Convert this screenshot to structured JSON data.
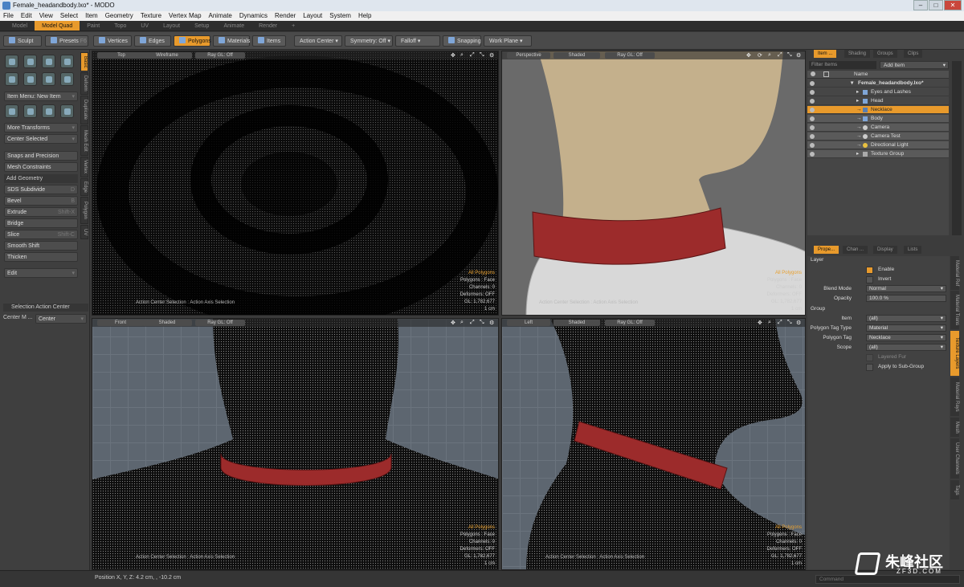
{
  "window": {
    "title": "Female_headandbody.lxo* - MODO",
    "controls": [
      "–",
      "□",
      "✕"
    ]
  },
  "menu": [
    "File",
    "Edit",
    "View",
    "Select",
    "Item",
    "Geometry",
    "Texture",
    "Vertex Map",
    "Animate",
    "Dynamics",
    "Render",
    "Layout",
    "System",
    "Help"
  ],
  "layout_tabs": [
    {
      "label": "Model",
      "active": false
    },
    {
      "label": "Model Quad",
      "active": true
    },
    {
      "label": "Paint",
      "active": false
    },
    {
      "label": "Topo",
      "active": false
    },
    {
      "label": "UV",
      "active": false
    },
    {
      "label": "Layout",
      "active": false
    },
    {
      "label": "Setup",
      "active": false
    },
    {
      "label": "Animate",
      "active": false
    },
    {
      "label": "Render",
      "active": false
    },
    {
      "label": "+",
      "active": false
    }
  ],
  "toolbar": {
    "sculpt": "Sculpt",
    "presets": "Presets",
    "presets_key": "F6",
    "vertices": "Vertices",
    "edges": "Edges",
    "polygons": "Polygons",
    "materials": "Materials",
    "items": "Items",
    "action_center": "Action Center",
    "symmetry": "Symmetry: Off",
    "falloff": "Falloff",
    "snapping": "Snapping",
    "work_plane": "Work Plane"
  },
  "left": {
    "item_menu": "Item Menu: New Item",
    "more_transforms": "More Transforms",
    "center_selected": "Center Selected",
    "snaps": "Snaps and Precision",
    "mesh_constraints": "Mesh Constraints",
    "add_geometry": "Add Geometry",
    "tools": [
      {
        "label": "SDS Subdivide",
        "key": "D"
      },
      {
        "label": "Bevel",
        "key": "B"
      },
      {
        "label": "Extrude",
        "key": "Shift-X"
      },
      {
        "label": "Bridge",
        "key": ""
      },
      {
        "label": "Slice",
        "key": "Shift-C"
      },
      {
        "label": "Smooth Shift",
        "key": ""
      },
      {
        "label": "Thicken",
        "key": ""
      }
    ],
    "edit": "Edit",
    "selection_action_center": "Selection Action Center",
    "center_mode_label": "Center M ...",
    "center_mode_value": "Center",
    "vtabs": [
      {
        "label": "Basic",
        "active": true
      },
      {
        "label": "Deform",
        "active": false
      },
      {
        "label": "Duplicate",
        "active": false
      },
      {
        "label": "Mesh Edit",
        "active": false
      },
      {
        "label": "Vertex",
        "active": false
      },
      {
        "label": "Edge",
        "active": false
      },
      {
        "label": "Polygon",
        "active": false
      },
      {
        "label": "UV",
        "active": false
      }
    ]
  },
  "viewports": {
    "top": {
      "view": "Top",
      "shade": "Wireframe",
      "ray": "Ray GL: Off",
      "info": [
        "All Polygons",
        "Polygons : Face",
        "Channels: 0",
        "Deformers: OFF",
        "GL: 1,782,677",
        "1 cm"
      ],
      "acs": "Action Center Selection : Action Axis Selection"
    },
    "persp": {
      "view": "Perspective",
      "shade": "Shaded",
      "ray": "Ray GL: Off",
      "info": [
        "All Polygons",
        "Polygons : Face",
        "Channels: 0",
        "Deformers: OFF",
        "GL: 1,782,677",
        "1 cm"
      ],
      "acs": "Action Center Selection : Action Axis Selection"
    },
    "front": {
      "view": "Front",
      "shade": "Shaded",
      "ray": "Ray GL: Off",
      "info": [
        "All Polygons",
        "Polygons : Face",
        "Channels: 0",
        "Deformers: OFF",
        "GL: 1,782,677",
        "1 cm"
      ],
      "acs": "Action Center Selection : Action Axis Selection"
    },
    "left": {
      "view": "Left",
      "shade": "Shaded",
      "ray": "Ray GL: Off",
      "info": [
        "All Polygons",
        "Polygons : Face",
        "Channels: 0",
        "Deformers: OFF",
        "GL: 1,782,677",
        "1 cm"
      ],
      "acs": "Action Center Selection : Action Axis Selection"
    }
  },
  "items_panel": {
    "tabs": [
      {
        "label": "Item ...",
        "active": true
      },
      {
        "label": "Shading",
        "active": false
      },
      {
        "label": "Groups",
        "active": false
      },
      {
        "label": "Clips",
        "active": false
      }
    ],
    "filter": "Filter Items",
    "add_item": "Add Item",
    "name_col": "Name",
    "tree": [
      {
        "label": "Female_headandbody.lxo*",
        "indent": 0,
        "state": "root"
      },
      {
        "label": "Eyes and Lashes",
        "indent": 1,
        "state": ""
      },
      {
        "label": "Head",
        "indent": 1,
        "state": ""
      },
      {
        "label": "Necklace",
        "indent": 1,
        "state": "selected"
      },
      {
        "label": "Body",
        "indent": 1,
        "state": ""
      },
      {
        "label": "Camera",
        "indent": 1,
        "state": ""
      },
      {
        "label": "Camera Test",
        "indent": 1,
        "state": ""
      },
      {
        "label": "Directional Light",
        "indent": 1,
        "state": ""
      },
      {
        "label": "Texture Group",
        "indent": 1,
        "state": ""
      }
    ]
  },
  "props_panel": {
    "tabs": [
      {
        "label": "Prope...",
        "active": true
      },
      {
        "label": "Chan ...",
        "active": false
      },
      {
        "label": "Display",
        "active": false
      },
      {
        "label": "Lists",
        "active": false
      }
    ],
    "layer": "Layer",
    "enable": "Enable",
    "invert": "Invert",
    "blend_mode_label": "Blend Mode",
    "blend_mode": "Normal",
    "opacity_label": "Opacity",
    "opacity": "100.0 %",
    "group": "Group",
    "item_label": "Item",
    "item": "(all)",
    "ptt_label": "Polygon Tag Type",
    "ptt": "Material",
    "ptag_label": "Polygon Tag",
    "ptag": "Necklace",
    "scope_label": "Scope",
    "scope": "(all)",
    "layered_fur": "Layered Fur",
    "apply_sub": "Apply to Sub-Group",
    "vtabs": [
      {
        "label": "Material Ref",
        "active": false
      },
      {
        "label": "Material Trans",
        "active": false
      },
      {
        "label": "Texture Layers",
        "active": true
      },
      {
        "label": "Material Rays",
        "active": false
      },
      {
        "label": "Mesh",
        "active": false
      },
      {
        "label": "User Channels",
        "active": false
      },
      {
        "label": "Tags",
        "active": false
      }
    ]
  },
  "status": {
    "position": "Position X, Y, Z:  4.2 cm, , -10.2 cm",
    "command": "Command"
  },
  "watermark": {
    "brand": "朱峰社区",
    "site": "ZF3D.COM"
  }
}
